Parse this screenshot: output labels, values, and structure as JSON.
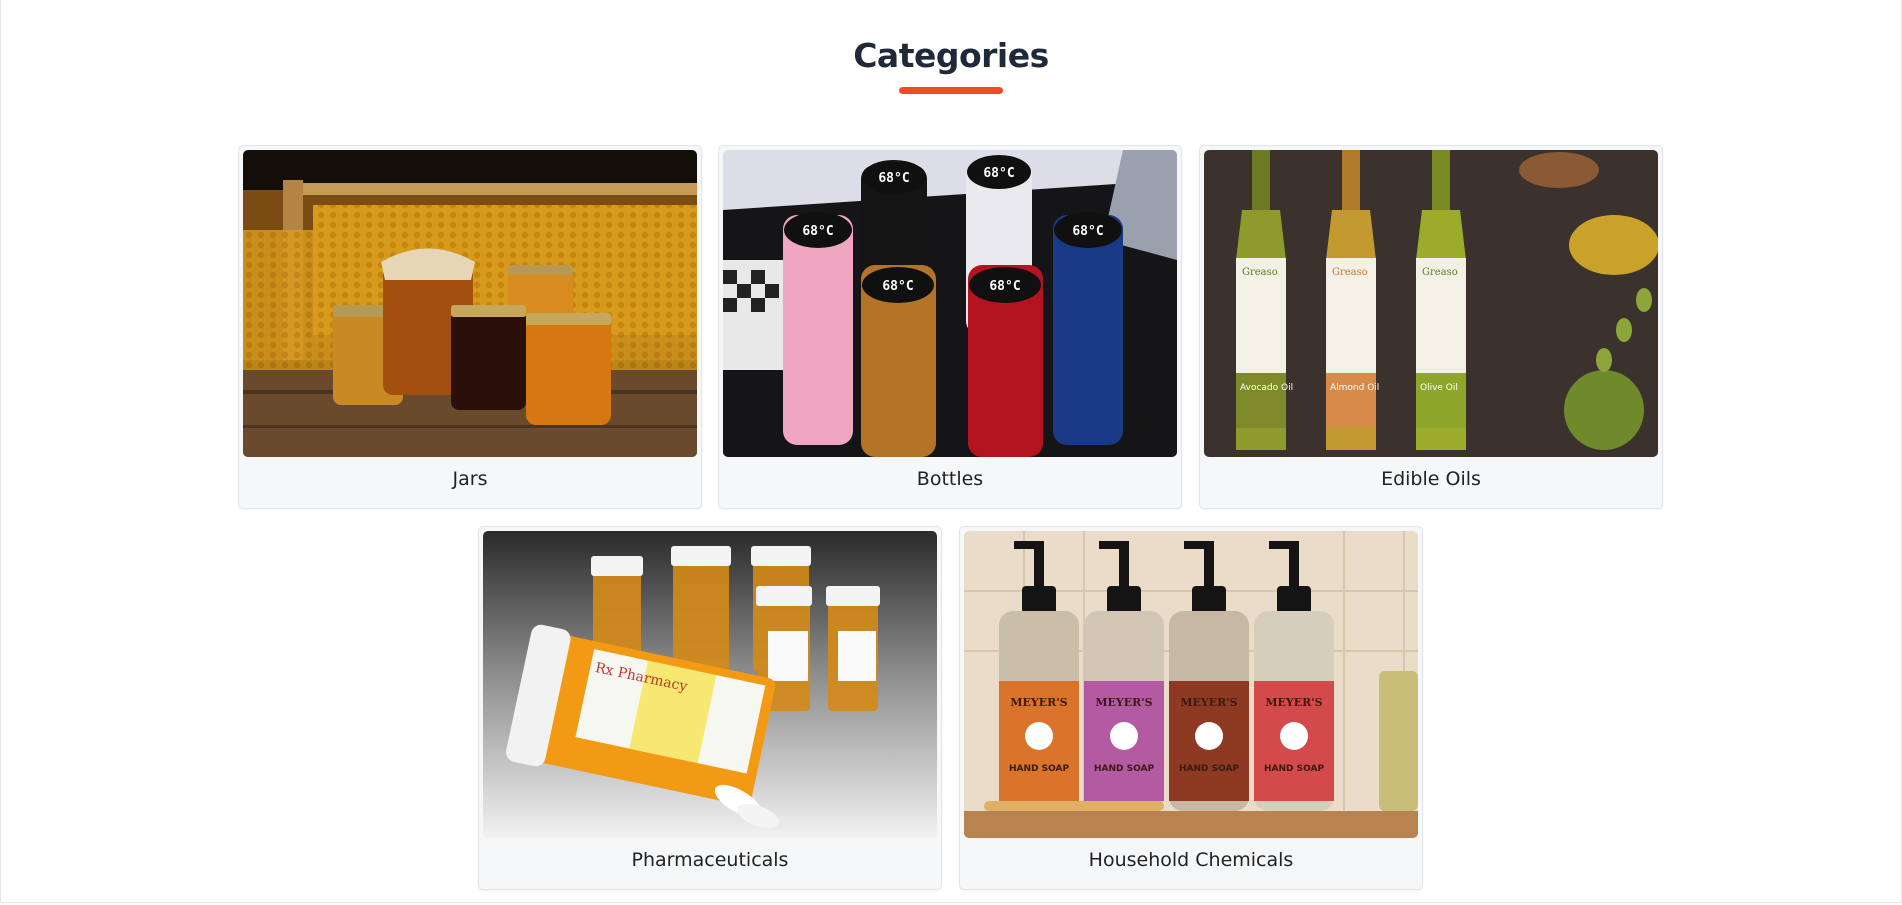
{
  "section": {
    "title": "Categories",
    "accent_color": "#ef4b2a"
  },
  "categories": [
    {
      "label": "Jars",
      "image_icon": "honey-jars-photo"
    },
    {
      "label": "Bottles",
      "image_icon": "thermos-bottles-photo",
      "display_text": "68°C"
    },
    {
      "label": "Edible Oils",
      "image_icon": "oil-bottles-photo",
      "brand": "Greaso",
      "products": [
        "Avocado Oil",
        "Almond Oil",
        "Olive Oil"
      ]
    },
    {
      "label": "Pharmaceuticals",
      "image_icon": "pill-bottles-photo",
      "bottle_text": "Rx Pharmacy"
    },
    {
      "label": "Household Chemicals",
      "image_icon": "hand-soap-photo",
      "brand": "MEYER'S",
      "product": "HAND SOAP"
    }
  ]
}
